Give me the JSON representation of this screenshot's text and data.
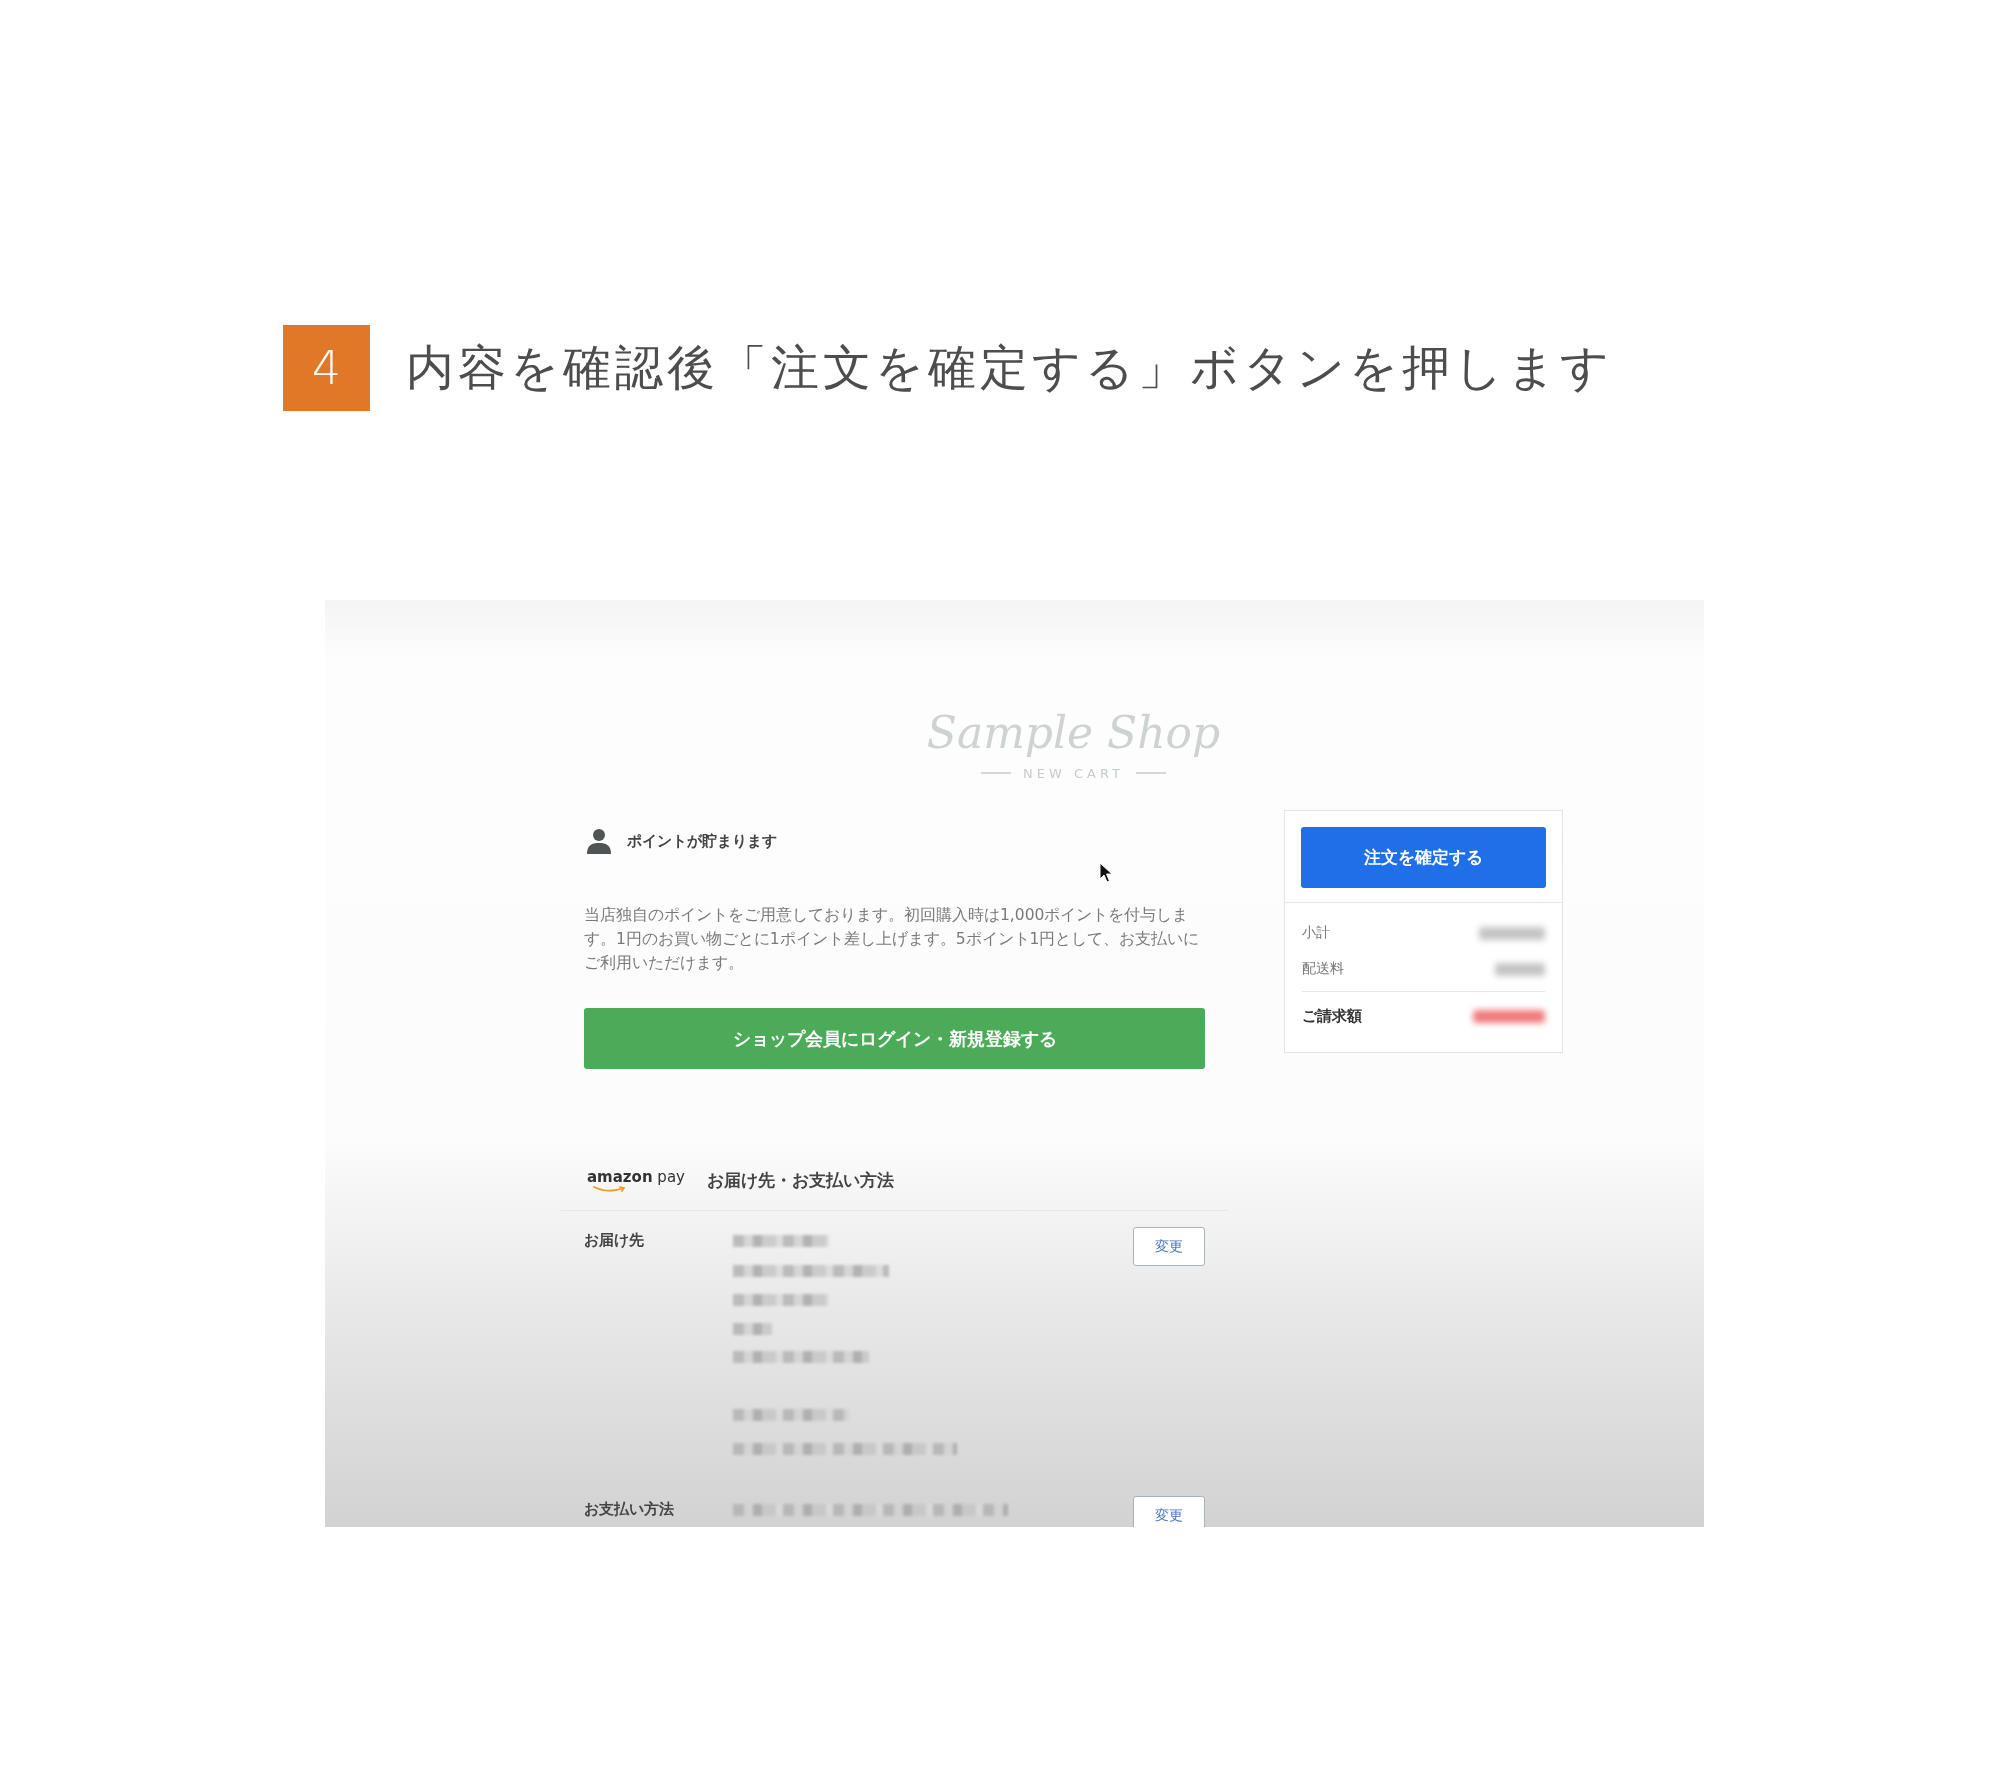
{
  "step": {
    "number": "4",
    "title": "内容を確認後「注文を確定する」ボタンを押します"
  },
  "screenshot": {
    "logo": {
      "name": "Sample Shop",
      "tagline": "NEW CART"
    },
    "points": {
      "heading": "ポイントが貯まります",
      "description": "当店独自のポイントをご用意しております。初回購入時は1,000ポイントを付与します。1円のお買い物ごとに1ポイント差し上げます。5ポイント1円として、お支払いにご利用いただけます。",
      "login_button": "ショップ会員にログイン・新規登録する"
    },
    "summary": {
      "confirm_button": "注文を確定する",
      "rows": [
        {
          "label": "小計",
          "kind": "line"
        },
        {
          "label": "配送料",
          "kind": "line"
        },
        {
          "label": "ご請求額",
          "kind": "total"
        }
      ]
    },
    "amazon_pay": {
      "logo": "**amazon** pay",
      "heading": "お届け先・お支払い方法",
      "rows": [
        {
          "label": "お届け先",
          "button": "変更"
        },
        {
          "label": "お支払い方法",
          "button": "変更"
        }
      ]
    }
  }
}
